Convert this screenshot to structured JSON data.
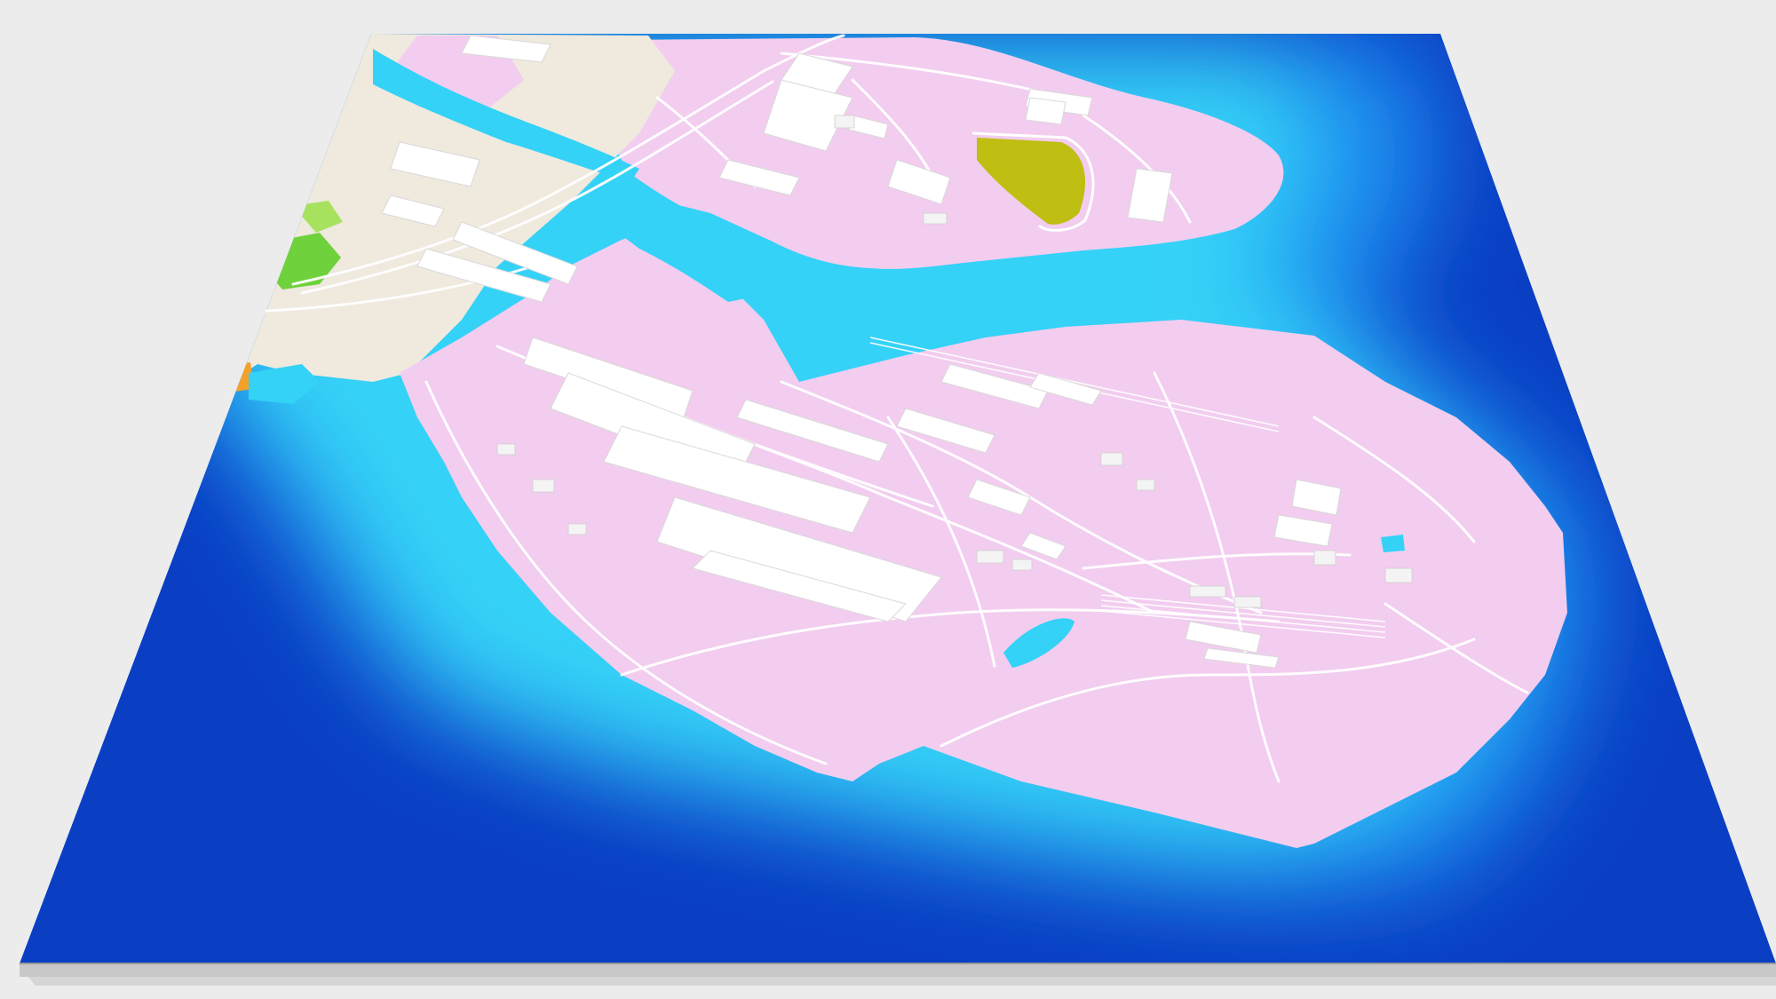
{
  "scene": {
    "kind": "3d-map-render",
    "background": "#ececec",
    "colors": {
      "water_deep": "#0a3fc4",
      "water_mid": "#1a8ef0",
      "water_shallow": "#34d2f7",
      "land": "#f2cdef",
      "land_edge": "#f6dcf2",
      "buildings": "#ffffff",
      "roads": "#ffffff",
      "park": "#bfbe12",
      "greenery": "#6fd13b",
      "accent_orange": "#f2a12a",
      "urban": "#efe9de",
      "slab_side": "#c8c8c8",
      "slab_edge": "#9a9a9a"
    },
    "features": [
      {
        "name": "main-industrial-island",
        "type": "land"
      },
      {
        "name": "northern-island",
        "type": "land"
      },
      {
        "name": "waterway-channel",
        "type": "water"
      },
      {
        "name": "city-district",
        "type": "urban"
      },
      {
        "name": "park-area",
        "type": "park"
      },
      {
        "name": "factory-buildings",
        "type": "buildings"
      },
      {
        "name": "road-network",
        "type": "roads"
      },
      {
        "name": "railway-yard",
        "type": "rail"
      }
    ]
  }
}
